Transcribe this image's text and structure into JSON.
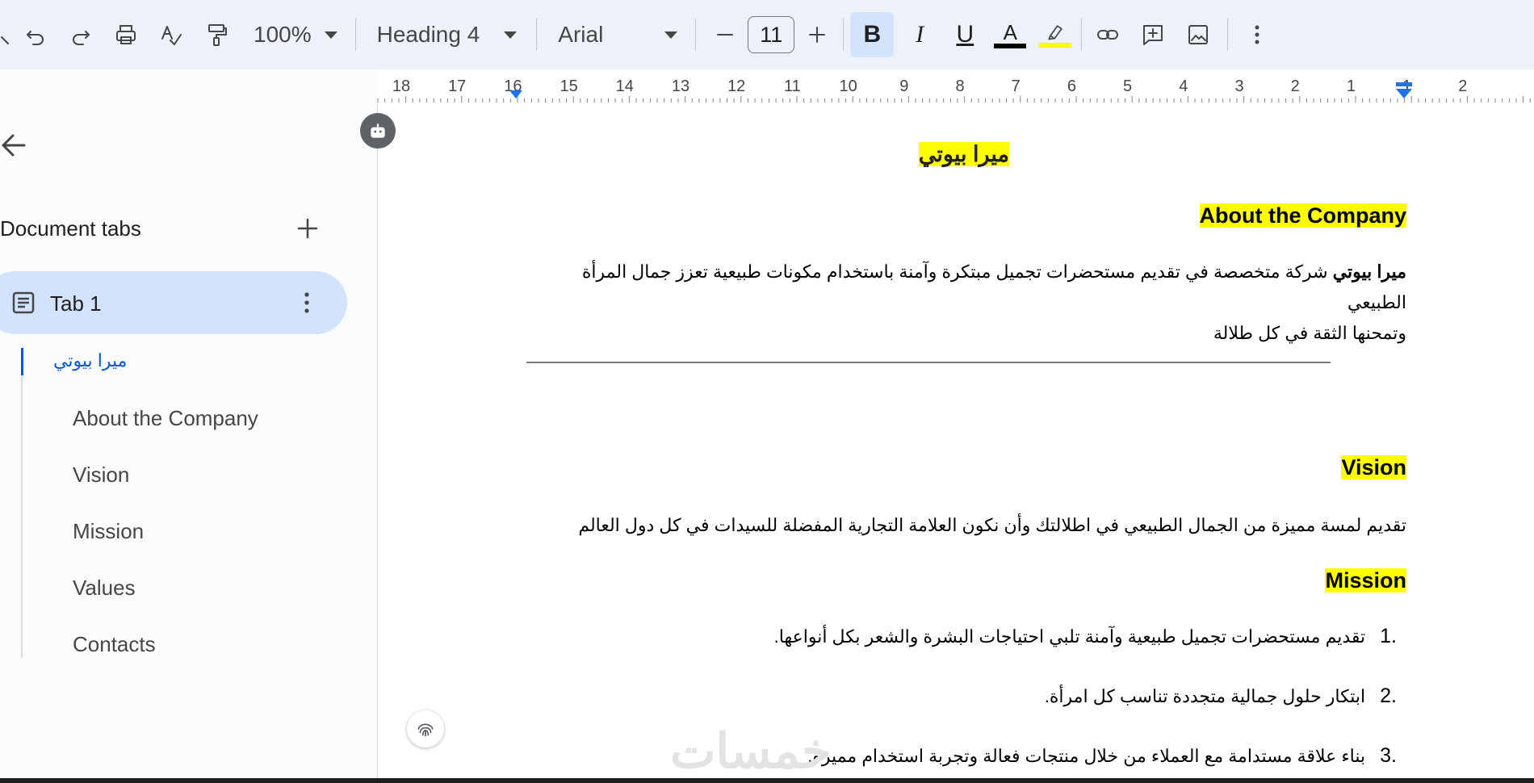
{
  "toolbar": {
    "zoom": "100%",
    "style": "Heading 4",
    "font": "Arial",
    "font_size": "11",
    "bold": "B",
    "italic": "I",
    "underline": "U",
    "text_color": "A",
    "text_color_swatch": "#000000",
    "highlight_swatch": "#ffff00"
  },
  "ruler": {
    "labels": [
      "18",
      "17",
      "16",
      "15",
      "14",
      "13",
      "12",
      "11",
      "10",
      "9",
      "8",
      "7",
      "6",
      "5",
      "4",
      "3",
      "2",
      "1",
      "1",
      "2"
    ]
  },
  "sidebar": {
    "title": "Document tabs",
    "tab_label": "Tab 1",
    "outline": [
      {
        "label": "ميرا بيوتي",
        "active": true
      },
      {
        "label": "About the Company"
      },
      {
        "label": "Vision"
      },
      {
        "label": "Mission"
      },
      {
        "label": "Values"
      },
      {
        "label": "Contacts"
      }
    ]
  },
  "document": {
    "title": "ميرا بيوتي",
    "about_heading": "About the Company",
    "about_text_bold": "ميرا بيوتي",
    "about_text_line1": " شركة متخصصة في تقديم مستحضرات تجميل مبتكرة وآمنة باستخدام مكونات طبيعية تعزز جمال المرأة الطبيعي",
    "about_text_line2": "وتمحنها الثقة في كل طلالة",
    "vision_heading": "Vision",
    "vision_text": "تقديم لمسة  مميزة من الجمال الطبيعي في اطلالتك وأن نكون العلامة التجارية المفضلة للسيدات في كل دول العالم",
    "mission_heading": "Mission",
    "mission_items": [
      {
        "num": "1.",
        "text": "تقديم مستحضرات تجميل طبيعية وآمنة تلبي احتياجات البشرة والشعر بكل أنواعها."
      },
      {
        "num": "2.",
        "text": "ابتكار حلول جمالية متجددة تناسب كل امرأة."
      },
      {
        "num": "3.",
        "text": "بناء علاقة مستدامة مع العملاء من خلال منتجات فعالة وتجربة استخدام مميزة."
      }
    ],
    "highlight_color": "#ffff00"
  },
  "watermark": "خمسات"
}
